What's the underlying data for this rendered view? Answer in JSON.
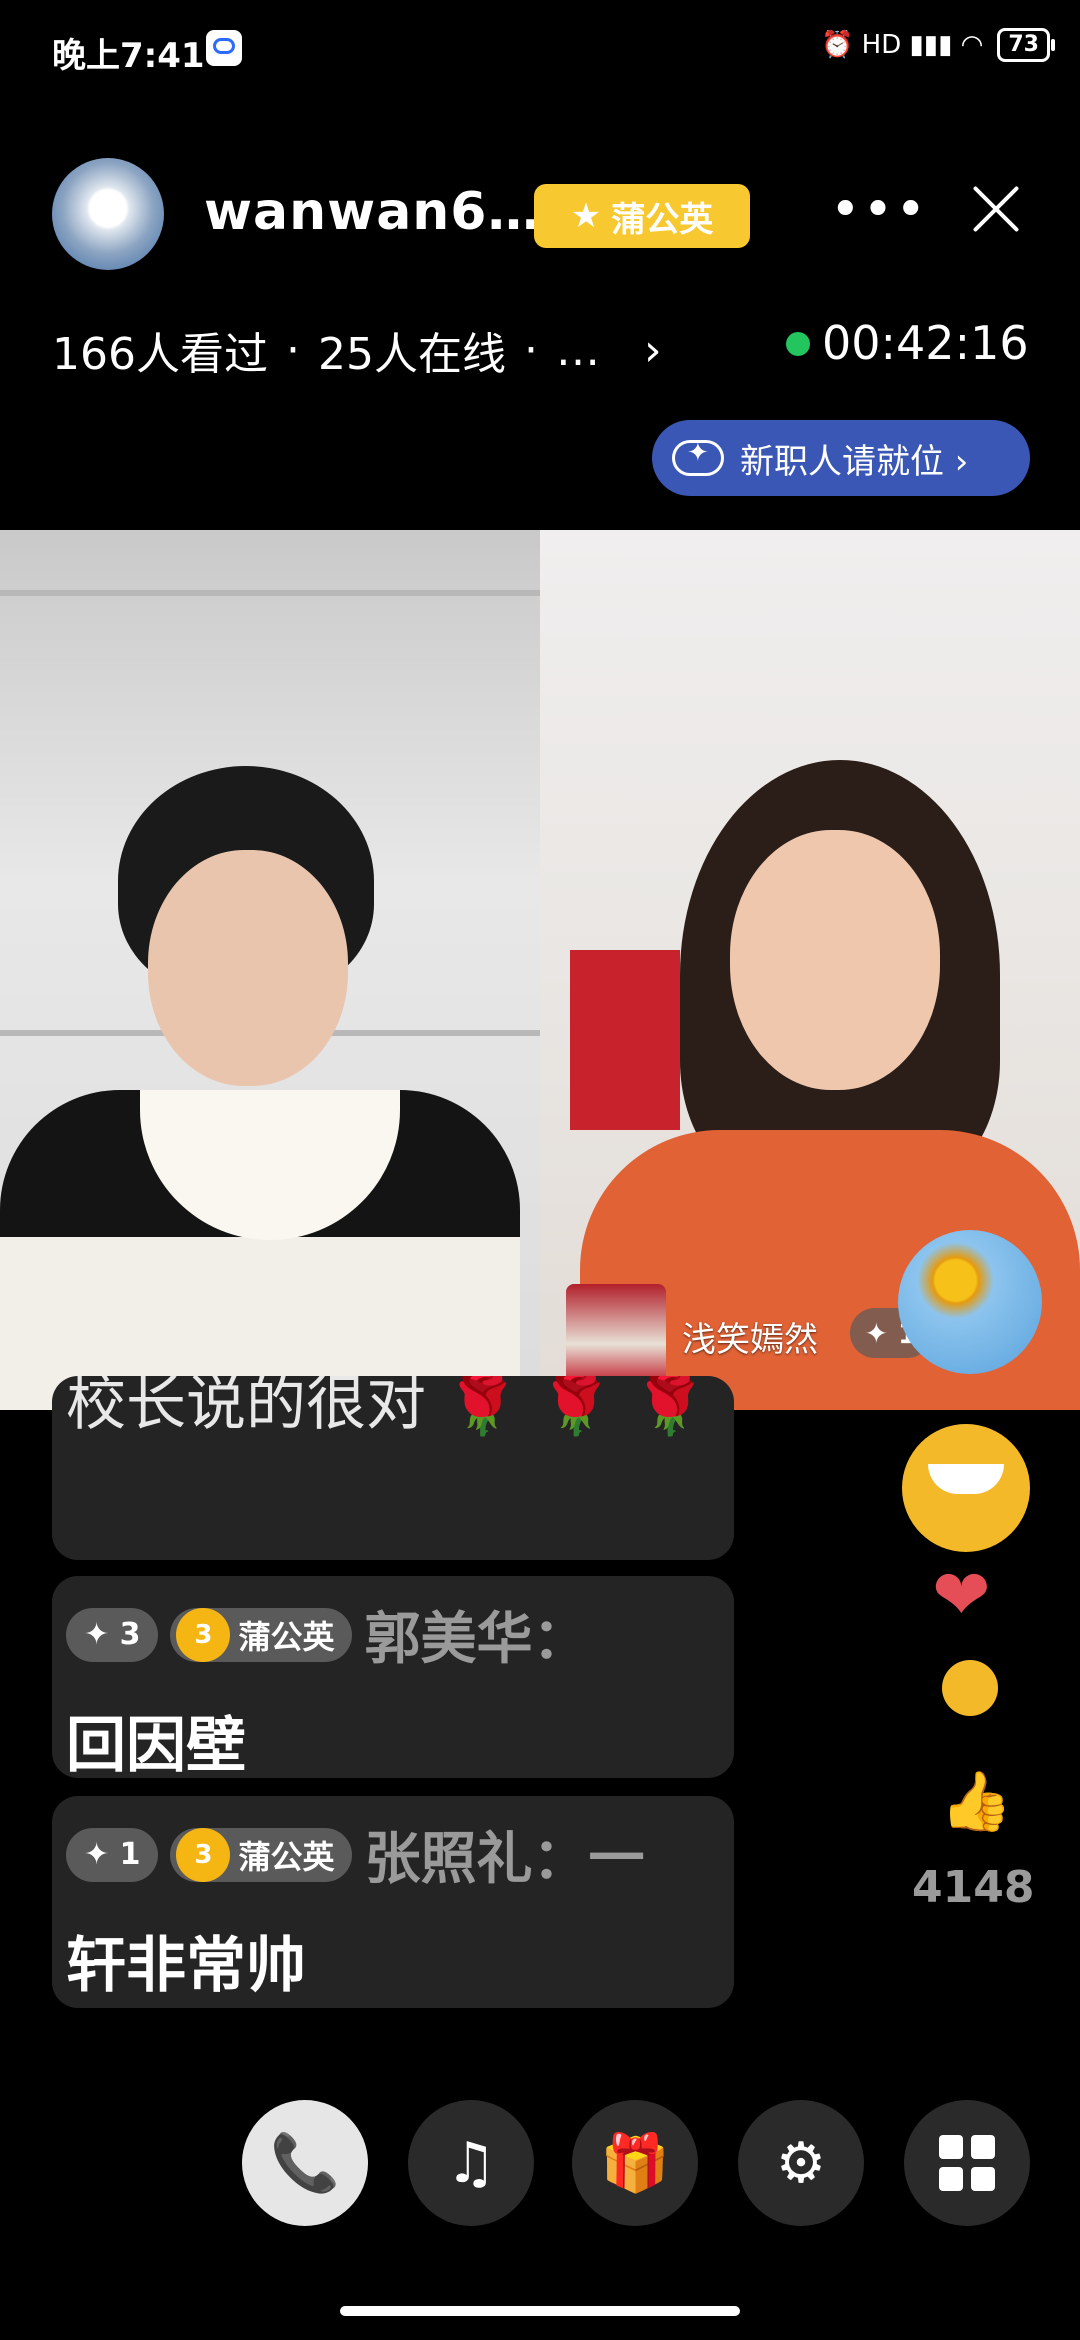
{
  "status_bar": {
    "time": "晚上7:41",
    "icons": "⏰ HD ▮▮▮ ◠",
    "battery": "73"
  },
  "header": {
    "host_name": "wanwan6…",
    "fan_badge": "蒲公英",
    "more_glyph": "•••",
    "stats": {
      "viewed": "166人看过",
      "online": "25人在线",
      "more": "…",
      "chevron": "›"
    },
    "live_duration": "00:42:16",
    "task_pill": "新职人请就位 ›"
  },
  "guest": {
    "name": "浅笑嫣然",
    "level": "✦ 1"
  },
  "comments": [
    {
      "text": "校长说的很对 🌹 🌹 🌹"
    },
    {
      "level": "✦ 3",
      "fan_level": "3",
      "fan_badge": "蒲公英",
      "user": "郭美华：",
      "text": "回因壁"
    },
    {
      "level": "✦ 1",
      "fan_level": "3",
      "fan_badge": "蒲公英",
      "user": "张照礼：一",
      "text": "轩非常帅"
    }
  ],
  "reactions": {
    "heart": "❤",
    "like_icon": "👍",
    "like_count": "4148"
  },
  "toolbar": {
    "call_icon": "📞",
    "music_icon": "♫",
    "gift_icon": "🎁",
    "settings_icon": "⚙"
  }
}
